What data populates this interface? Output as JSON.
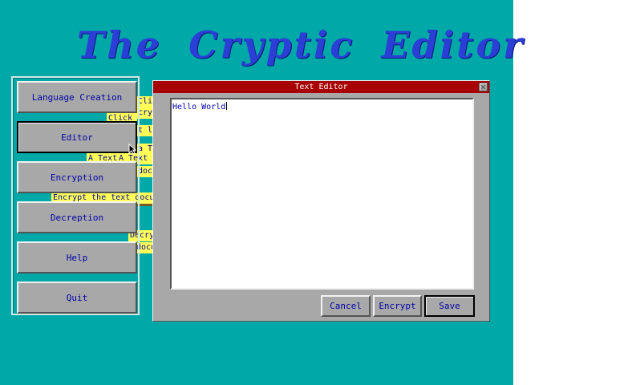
{
  "app": {
    "title": "The Cryptic Editor"
  },
  "menu": {
    "items": [
      {
        "label": "Language Creation"
      },
      {
        "label": "Editor"
      },
      {
        "label": "Encryption"
      },
      {
        "label": "Decreption"
      },
      {
        "label": "Help"
      },
      {
        "label": "Quit"
      }
    ],
    "active_item": "Editor"
  },
  "tooltips": [
    "Clic",
    "cry",
    "Click",
    "t la",
    "a Te",
    "A Text",
    "A Text e",
    "docum",
    "Encrypt the text docu",
    "Decry",
    "docu"
  ],
  "editor_window": {
    "title": "Text Editor",
    "content": "Hello World",
    "buttons": {
      "cancel": "Cancel",
      "encrypt": "Encrypt",
      "save": "Save"
    },
    "default_button": "Save"
  },
  "colors": {
    "desktop": "#00a8a8",
    "title_text": "#2b3fd6",
    "window_title_bar": "#a80000",
    "button_face": "#a8a8a8",
    "button_text": "#0000a8",
    "tooltip_bg": "#ffff55"
  },
  "icons": {
    "cursor": "mouse-pointer-icon",
    "close": "close-icon"
  }
}
